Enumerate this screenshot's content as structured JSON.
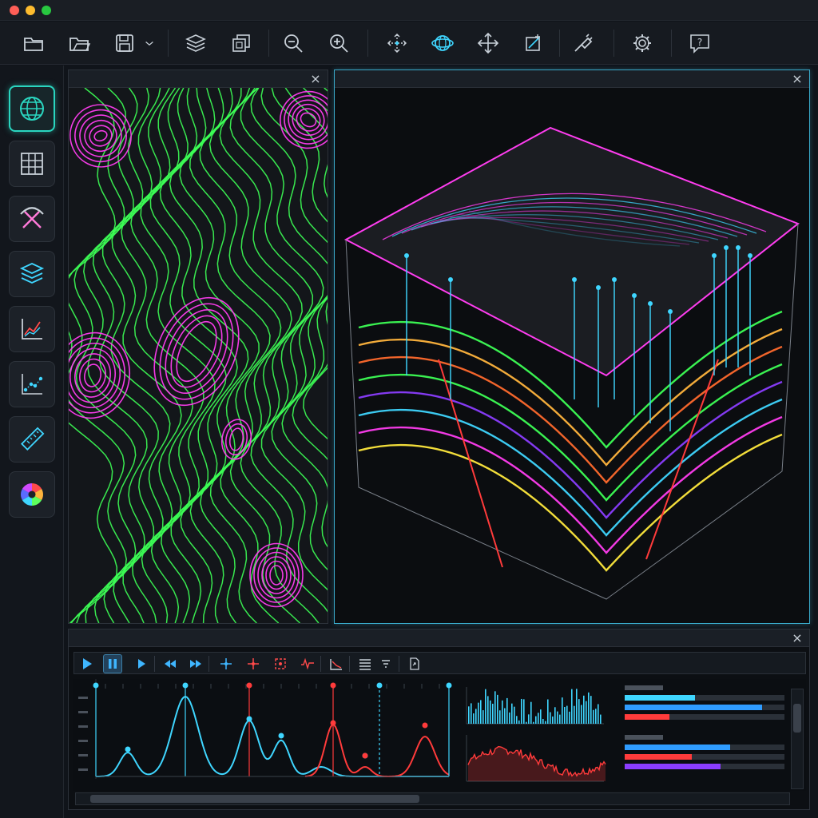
{
  "window": {
    "traffic_lights": [
      "#ff5f57",
      "#febc2e",
      "#28c840"
    ]
  },
  "toolbar": {
    "buttons": [
      {
        "name": "open-folder-icon"
      },
      {
        "name": "open-project-icon"
      },
      {
        "name": "save-icon"
      },
      {
        "name": "save-dropdown-chevron-icon"
      },
      {
        "name": "layers-icon"
      },
      {
        "name": "copy-layer-icon"
      },
      {
        "name": "zoom-out-icon"
      },
      {
        "name": "zoom-in-icon"
      },
      {
        "name": "move-point-icon"
      },
      {
        "name": "rotate-3d-icon"
      },
      {
        "name": "pan-icon"
      },
      {
        "name": "crop-icon"
      },
      {
        "name": "probe-icon"
      },
      {
        "name": "settings-icon"
      },
      {
        "name": "help-icon"
      }
    ],
    "help_label": "?"
  },
  "sidebar": {
    "items": [
      {
        "name": "globe-icon",
        "active": true
      },
      {
        "name": "grid-icon",
        "active": false
      },
      {
        "name": "pickaxe-icon",
        "active": false
      },
      {
        "name": "layers-stack-icon",
        "active": false
      },
      {
        "name": "line-chart-icon",
        "active": false
      },
      {
        "name": "scatter-plot-icon",
        "active": false
      },
      {
        "name": "ruler-icon",
        "active": false
      },
      {
        "name": "color-wheel-icon",
        "active": false
      }
    ]
  },
  "panels": {
    "map": {
      "close_label": "×"
    },
    "view3d": {
      "close_label": "×"
    },
    "bottom": {
      "close_label": "×"
    }
  },
  "playback": {
    "buttons": [
      "play-icon",
      "pause-icon",
      "step-forward-icon",
      "rewind-icon",
      "fast-forward-icon",
      "add-marker-icon",
      "add-red-marker-icon",
      "frame-select-icon",
      "signal-icon",
      "trend-icon",
      "list-icon",
      "list-filter-icon",
      "export-icon"
    ],
    "active": "pause-icon"
  },
  "colors": {
    "accent": "#2ad6c0",
    "contour_green": "#3dff55",
    "contour_magenta": "#ff3df0",
    "cyan": "#3fd6ff",
    "red": "#ff3b3b",
    "blue_bar": "#2f9cff",
    "purple_bar": "#8b3dff"
  },
  "bars": {
    "group1": [
      0.44,
      0.86,
      0.28
    ],
    "group2": [
      0.66,
      0.42,
      0.6
    ]
  }
}
